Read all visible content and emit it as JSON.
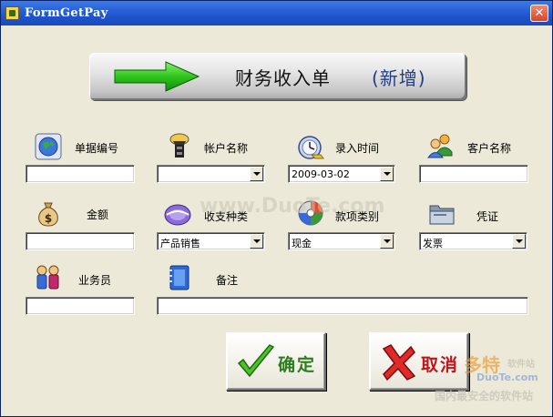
{
  "window": {
    "title": "FormGetPay",
    "close_glyph": "✕"
  },
  "banner": {
    "title": "财务收入单",
    "subtitle": "(新增)",
    "icon": "green-arrow-icon"
  },
  "fields": {
    "doc_number": {
      "label": "单据编号",
      "value": "",
      "icon": "globe-icon"
    },
    "account_name": {
      "label": "帐户名称",
      "value": "",
      "icon": "lighthouse-icon"
    },
    "entry_time": {
      "label": "录入时间",
      "value": "2009-03-02",
      "icon": "clock-cd-icon"
    },
    "customer_name": {
      "label": "客户名称",
      "value": "",
      "icon": "customers-icon"
    },
    "amount": {
      "label": "金额",
      "value": "",
      "icon": "money-bag-icon"
    },
    "trans_type": {
      "label": "收支种类",
      "value": "产品销售",
      "icon": "swirl-disc-icon"
    },
    "payment_type": {
      "label": "款项类别",
      "value": "现金",
      "icon": "disc-icon"
    },
    "voucher": {
      "label": "凭证",
      "value": "发票",
      "icon": "folder-icon"
    },
    "salesperson": {
      "label": "业务员",
      "value": "",
      "icon": "people-icon"
    },
    "remark": {
      "label": "备注",
      "value": "",
      "icon": "notebook-icon"
    }
  },
  "buttons": {
    "confirm": {
      "label": "确定",
      "icon": "green-check-icon",
      "color": "#2e7d1e"
    },
    "cancel": {
      "label": "取消",
      "icon": "red-x-icon",
      "color": "#c0151b"
    }
  },
  "watermarks": {
    "center": "www.DuoTe.com",
    "brand": "多特",
    "brand_suffix": "软件站",
    "domain": "DuoTe.com",
    "slogan": "国内最安全的软件站"
  },
  "colors": {
    "titlebar": "#2a63d8",
    "dialog_bg": "#ece9d8",
    "banner_subtitle": "#1f3d8a"
  }
}
